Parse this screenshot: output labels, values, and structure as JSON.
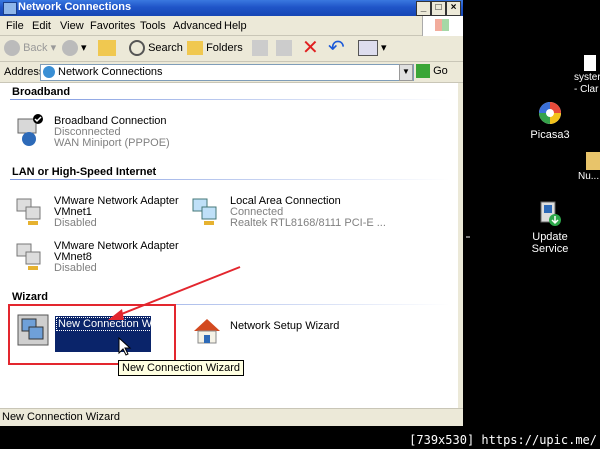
{
  "window": {
    "title": "Network Connections"
  },
  "menu": [
    "File",
    "Edit",
    "View",
    "Favorites",
    "Tools",
    "Advanced",
    "Help"
  ],
  "toolbar": {
    "back": "Back",
    "search": "Search",
    "folders": "Folders"
  },
  "address": {
    "label": "Address",
    "value": "Network Connections",
    "go": "Go"
  },
  "groups": {
    "broadband": "Broadband",
    "lan": "LAN or High-Speed Internet",
    "wizard": "Wizard"
  },
  "connections": {
    "broadband": {
      "name": "Broadband Connection",
      "status": "Disconnected",
      "device": "WAN Miniport (PPPOE)"
    },
    "vmnet1": {
      "name": "VMware Network Adapter",
      "name2": "VMnet1",
      "status": "Disabled"
    },
    "lan": {
      "name": "Local Area Connection",
      "status": "Connected",
      "device": "Realtek RTL8168/8111 PCI-E ..."
    },
    "vmnet8": {
      "name": "VMware Network Adapter",
      "name2": "VMnet8",
      "status": "Disabled"
    }
  },
  "wizards": {
    "new_connection": "New Connection Wizard",
    "network_setup": "Network Setup Wizard"
  },
  "tooltip": "New Connection Wizard",
  "statusbar": "New Connection Wizard",
  "desktop": {
    "picasa": "Picasa3",
    "update": "Update Service",
    "sys": "syster - Clar",
    "nu": "Nu..."
  },
  "watermark": "[739x530] https://upic.me/",
  "colors": {
    "titlebar": "#1f55c8",
    "selection": "#0a246a",
    "annotation": "#e3262e"
  }
}
